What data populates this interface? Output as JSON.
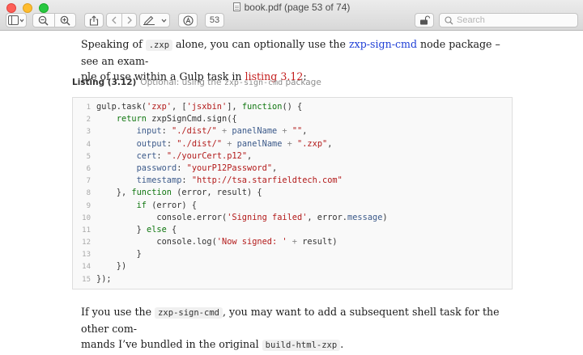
{
  "window": {
    "title": "book.pdf (page 53 of 74)",
    "page_field": "53",
    "search_placeholder": "Search"
  },
  "page": {
    "para1": {
      "t1": "Speaking of ",
      "c1": ".zxp",
      "t2": " alone, you can optionally use the ",
      "link1": "zxp-sign-cmd",
      "t3": " node package – see an exam-",
      "t4": "ple of use within a Gulp task in ",
      "link2": "listing 3.12",
      "t5": ":"
    },
    "listing": {
      "label": "Listing (3.12)",
      "caption_text": "Optional: using the ",
      "caption_code": "zxp-sign-cmd",
      "caption_tail": " package"
    },
    "code_lines": [
      [
        [
          "fn",
          "gulp.task("
        ],
        [
          "str",
          "'zxp'"
        ],
        [
          "fn",
          ", ["
        ],
        [
          "str",
          "'jsxbin'"
        ],
        [
          "fn",
          "], "
        ],
        [
          "kw",
          "function"
        ],
        [
          "fn",
          "() {"
        ]
      ],
      [
        [
          "fn",
          "    "
        ],
        [
          "kw",
          "return"
        ],
        [
          "fn",
          " zxpSignCmd.sign({"
        ]
      ],
      [
        [
          "fn",
          "        "
        ],
        [
          "prop",
          "input"
        ],
        [
          "fn",
          ": "
        ],
        [
          "str",
          "\"./dist/\""
        ],
        [
          "op",
          " + "
        ],
        [
          "var",
          "panelName"
        ],
        [
          "op",
          " + "
        ],
        [
          "str",
          "\"\""
        ],
        [
          "fn",
          ","
        ]
      ],
      [
        [
          "fn",
          "        "
        ],
        [
          "prop",
          "output"
        ],
        [
          "fn",
          ": "
        ],
        [
          "str",
          "\"./dist/\""
        ],
        [
          "op",
          " + "
        ],
        [
          "var",
          "panelName"
        ],
        [
          "op",
          " + "
        ],
        [
          "str",
          "\".zxp\""
        ],
        [
          "fn",
          ","
        ]
      ],
      [
        [
          "fn",
          "        "
        ],
        [
          "prop",
          "cert"
        ],
        [
          "fn",
          ": "
        ],
        [
          "str",
          "\"./yourCert.p12\""
        ],
        [
          "fn",
          ","
        ]
      ],
      [
        [
          "fn",
          "        "
        ],
        [
          "prop",
          "password"
        ],
        [
          "fn",
          ": "
        ],
        [
          "str",
          "\"yourP12Password\""
        ],
        [
          "fn",
          ","
        ]
      ],
      [
        [
          "fn",
          "        "
        ],
        [
          "prop",
          "timestamp"
        ],
        [
          "fn",
          ": "
        ],
        [
          "str",
          "\"http://tsa.starfieldtech.com\""
        ]
      ],
      [
        [
          "fn",
          "    }, "
        ],
        [
          "kw",
          "function"
        ],
        [
          "fn",
          " (error, result) {"
        ]
      ],
      [
        [
          "fn",
          "        "
        ],
        [
          "kw",
          "if"
        ],
        [
          "fn",
          " (error) {"
        ]
      ],
      [
        [
          "fn",
          "            console."
        ],
        [
          "fn",
          "error("
        ],
        [
          "str",
          "'Signing failed'"
        ],
        [
          "fn",
          ", error."
        ],
        [
          "prop",
          "message"
        ],
        [
          "fn",
          ")"
        ]
      ],
      [
        [
          "fn",
          "        } "
        ],
        [
          "kw",
          "else"
        ],
        [
          "fn",
          " {"
        ]
      ],
      [
        [
          "fn",
          "            console.log("
        ],
        [
          "str",
          "'Now signed: '"
        ],
        [
          "op",
          " + "
        ],
        [
          "fn",
          "result)"
        ]
      ],
      [
        [
          "fn",
          "        }"
        ]
      ],
      [
        [
          "fn",
          "    })"
        ]
      ],
      [
        [
          "fn",
          "});"
        ]
      ]
    ],
    "para2": {
      "t1": "If you use the ",
      "c1": "zxp-sign-cmd",
      "t2": ", you may want to add a subsequent shell task for the other com-",
      "t3": "mands I’ve bundled in the original ",
      "c2": "build-html-zxp",
      "t4": "."
    }
  },
  "icons": {
    "sidebar": "sidebar-toggle-icon",
    "zoom_out": "zoom-out-icon",
    "zoom_in": "zoom-in-icon",
    "share": "share-icon",
    "prev": "chevron-left-icon",
    "next": "chevron-right-icon",
    "markup": "pen-icon",
    "annotate": "annotate-icon",
    "lock": "lock-icon",
    "search": "search-icon"
  }
}
